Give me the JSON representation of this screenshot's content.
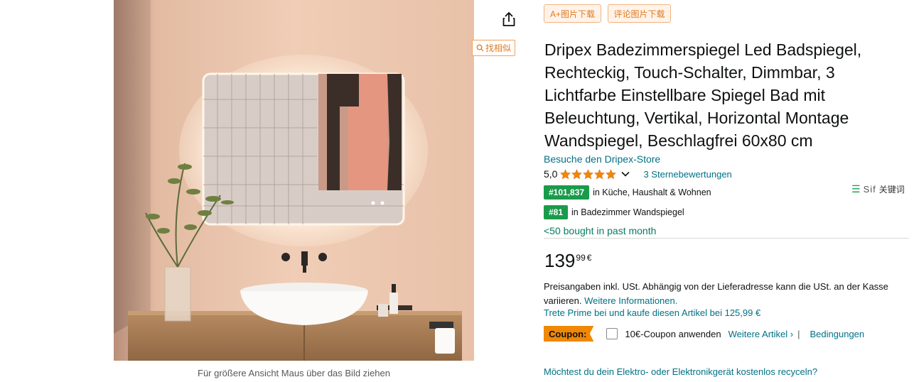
{
  "image": {
    "caption": "Für größere Ansicht Maus über das Bild ziehen"
  },
  "toolbar": {
    "chip_a_label": "A+图片下载",
    "chip_b_label": "评论图片下载",
    "similar_label": "找相似"
  },
  "product": {
    "title": "Dripex Badezimmerspiegel Led Badspiegel, Rechteckig, Touch-Schalter, Dimmbar, 3 Lichtfarbe Einstellbare Spiegel Bad mit Beleuchtung, Vertikal, Horizontal Montage Wandspiegel, Beschlagfrei 60x80 cm",
    "store_link": "Besuche den Dripex-Store",
    "rating_value": "5,0",
    "rating_stars": 5,
    "reviews_link": "3 Sternebewertungen",
    "ranks": [
      {
        "badge": "#101,837",
        "category": "in Küche, Haushalt & Wohnen"
      },
      {
        "badge": "#81",
        "category": "in Badezimmer Wandspiegel"
      }
    ],
    "bought": "<50 bought in past month"
  },
  "sidebar_tool": {
    "name": "Sif",
    "label": "关键词"
  },
  "pricing": {
    "whole": "139",
    "fraction": "99",
    "currency": "€",
    "tax_text": "Preisangaben inkl. USt. Abhängig von der Lieferadresse kann die USt. an der Kasse variieren.",
    "tax_link": "Weitere Informationen.",
    "prime_text": "Trete Prime bei und kaufe diesen Artikel bei 125,99 €"
  },
  "coupon": {
    "badge": "Coupon:",
    "label": "10€-Coupon anwenden",
    "more_link": "Weitere Artikel ›",
    "separator": "|",
    "terms_link": "Bedingungen"
  },
  "recycle_link": "Möchtest du dein Elektro- oder Elektronikgerät kostenlos recyceln?",
  "colors": {
    "link": "#007185",
    "rank_badge": "#1a9b4b",
    "star": "#f08804",
    "coupon_badge": "#f08804",
    "chip_border": "#f0b483",
    "chip_text": "#e07a1f"
  }
}
